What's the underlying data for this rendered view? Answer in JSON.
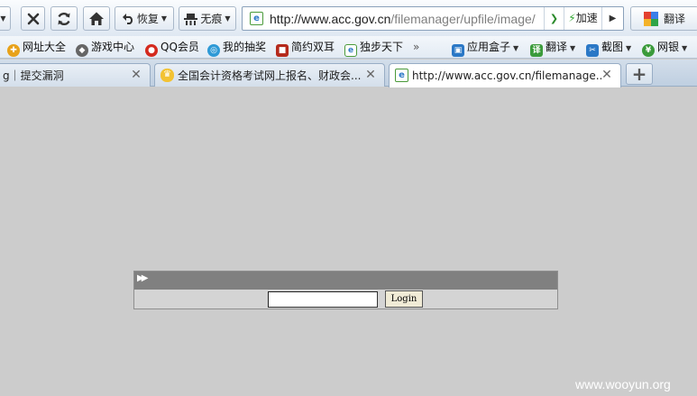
{
  "toolbar": {
    "restore_label": "恢复",
    "incognito_label": "无痕",
    "address_url_host": "http://www.acc.gov.cn",
    "address_url_path": "/filemanager/upfile/image/",
    "accelerate_label": "加速",
    "translate_label": "翻译"
  },
  "bookmarks": [
    {
      "label": "网址大全",
      "icon": "site-nav-icon",
      "color": "#e8a21a"
    },
    {
      "label": "游戏中心",
      "icon": "gamepad-icon",
      "color": "#555555"
    },
    {
      "label": "QQ会员",
      "icon": "qq-penguin-icon",
      "color": "#d42a1e"
    },
    {
      "label": "我的抽奖",
      "icon": "lottery-icon",
      "color": "#2f9ad6"
    },
    {
      "label": "简约双耳",
      "icon": "site-logo-icon",
      "color": "#b52a1c"
    },
    {
      "label": "独步天下",
      "icon": "page-icon",
      "color": "#4a9a3a"
    },
    {
      "label": "应用盒子",
      "icon": "app-box-icon",
      "color": "#2b78c6"
    },
    {
      "label": "翻译",
      "icon": "translate-icon",
      "color": "#3b9b3b"
    },
    {
      "label": "截图",
      "icon": "screenshot-icon",
      "color": "#2b78c6"
    },
    {
      "label": "网银",
      "icon": "online-bank-icon",
      "color": "#3b9b3b"
    }
  ],
  "bookmarks_more": "»",
  "tabs": [
    {
      "title": "g｜提交漏洞",
      "active": false
    },
    {
      "title": "全国会计资格考试网上报名、财政会...",
      "active": false
    },
    {
      "title": "http://www.acc.gov.cn/filemanage...",
      "active": true
    }
  ],
  "login": {
    "button_label": "Login",
    "input_value": ""
  },
  "watermark": "www.wooyun.org"
}
